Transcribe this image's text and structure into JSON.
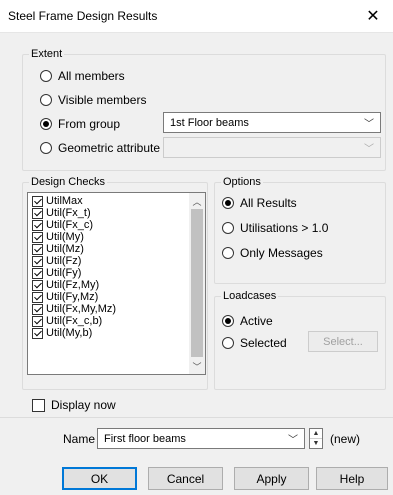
{
  "window": {
    "title": "Steel Frame Design Results",
    "close_icon": "close-icon"
  },
  "extent": {
    "legend": "Extent",
    "options": [
      {
        "label": "All members",
        "selected": false
      },
      {
        "label": "Visible members",
        "selected": false
      },
      {
        "label": "From group",
        "selected": true
      },
      {
        "label": "Geometric attribute",
        "selected": false
      }
    ],
    "group_combo_value": "1st Floor beams",
    "attribute_combo_value": ""
  },
  "design_checks": {
    "legend": "Design Checks",
    "items": [
      {
        "label": "UtilMax",
        "checked": true
      },
      {
        "label": "Util(Fx_t)",
        "checked": true
      },
      {
        "label": "Util(Fx_c)",
        "checked": true
      },
      {
        "label": "Util(My)",
        "checked": true
      },
      {
        "label": "Util(Mz)",
        "checked": true
      },
      {
        "label": "Util(Fz)",
        "checked": true
      },
      {
        "label": "Util(Fy)",
        "checked": true
      },
      {
        "label": "Util(Fz,My)",
        "checked": true
      },
      {
        "label": "Util(Fy,Mz)",
        "checked": true
      },
      {
        "label": "Util(Fx,My,Mz)",
        "checked": true
      },
      {
        "label": "Util(Fx_c,b)",
        "checked": true
      },
      {
        "label": "Util(My,b)",
        "checked": true
      }
    ]
  },
  "options": {
    "legend": "Options",
    "items": [
      {
        "label": "All Results",
        "selected": true
      },
      {
        "label": "Utilisations > 1.0",
        "selected": false
      },
      {
        "label": "Only Messages",
        "selected": false
      }
    ]
  },
  "loadcases": {
    "legend": "Loadcases",
    "items": [
      {
        "label": "Active",
        "selected": true
      },
      {
        "label": "Selected",
        "selected": false
      }
    ],
    "select_button": "Select..."
  },
  "display_now": {
    "label": "Display now",
    "checked": false
  },
  "name_row": {
    "label": "Name",
    "value": "First floor beams",
    "status": "(new)"
  },
  "buttons": {
    "ok": "OK",
    "cancel": "Cancel",
    "apply": "Apply",
    "help": "Help"
  }
}
